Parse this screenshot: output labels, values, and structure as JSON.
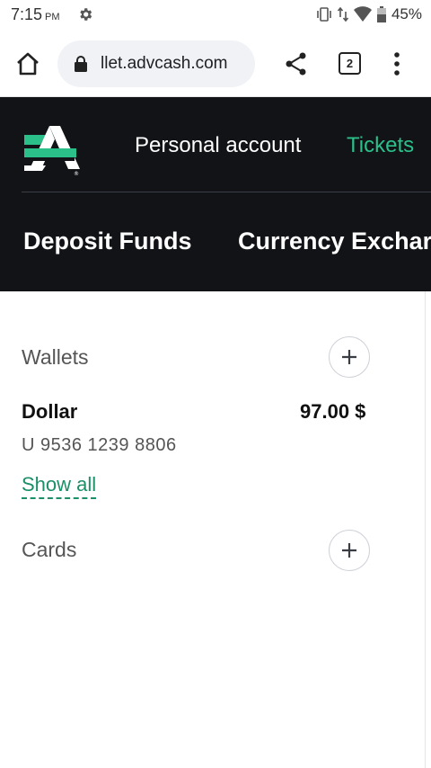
{
  "status_bar": {
    "time": "7:15",
    "ampm": "PM",
    "battery_percent": "45%",
    "icons": [
      "settings-gear-icon",
      "vibrate-icon",
      "data-arrows-icon",
      "wifi-icon",
      "battery-icon"
    ]
  },
  "browser": {
    "url": "llet.advcash.com",
    "tab_count": "2",
    "icons": [
      "home-icon",
      "lock-icon",
      "share-icon",
      "tabs-icon",
      "overflow-menu-icon"
    ]
  },
  "site_header": {
    "nav_primary": [
      "Personal account",
      "Tickets"
    ],
    "nav_secondary": [
      "Deposit Funds",
      "Currency Exchar"
    ],
    "accent_color": "#2bc08a",
    "background_color": "#111317"
  },
  "wallets": {
    "title": "Wallets",
    "items": [
      {
        "name": "Dollar",
        "amount": "97.00 $",
        "account": "U 9536 1239 8806"
      }
    ],
    "show_all_label": "Show all"
  },
  "cards": {
    "title": "Cards"
  }
}
